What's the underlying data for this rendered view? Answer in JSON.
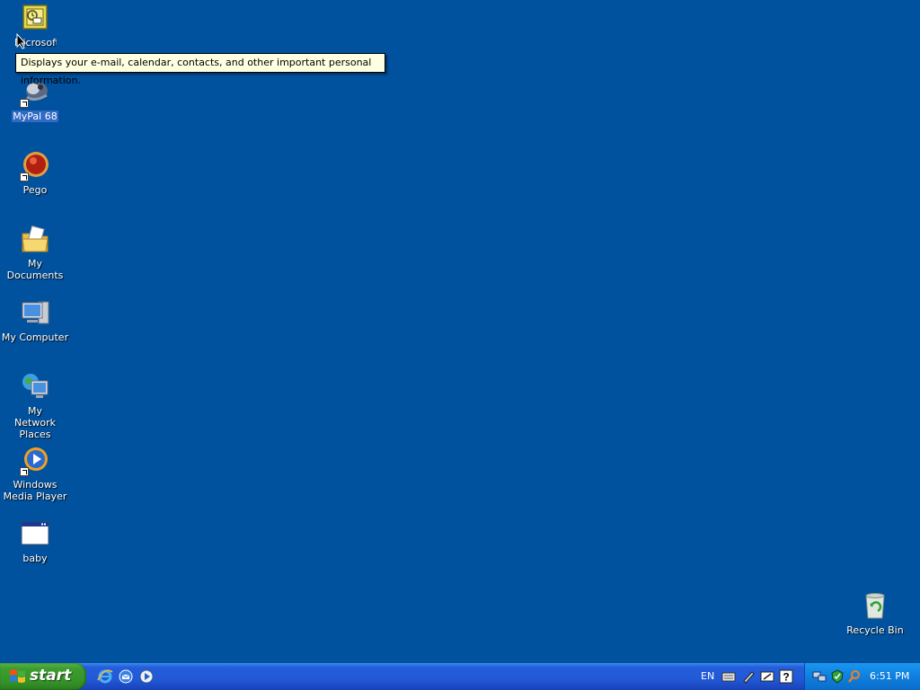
{
  "desktop": {
    "icons": [
      {
        "label": "Microsoft Outlook"
      },
      {
        "label": "MyPal 68"
      },
      {
        "label": "Pego"
      },
      {
        "label": "My Documents"
      },
      {
        "label": "My Computer"
      },
      {
        "label": "My Network Places"
      },
      {
        "label": "Windows Media Player"
      },
      {
        "label": "baby"
      },
      {
        "label": "Recycle Bin"
      }
    ],
    "tooltip": "Displays your e-mail, calendar, contacts, and other important personal information."
  },
  "taskbar": {
    "start_label": "start",
    "quick_launch": [
      "internet-explorer-icon",
      "outlook-express-icon",
      "media-player-icon"
    ],
    "language": "EN",
    "clock": "6:51 PM"
  },
  "colors": {
    "desktop_bg": "#00519e",
    "taskbar": "#245edb",
    "start_button": "#3c9e2e",
    "tray": "#0f80e0",
    "tooltip_bg": "#ffffe1"
  }
}
